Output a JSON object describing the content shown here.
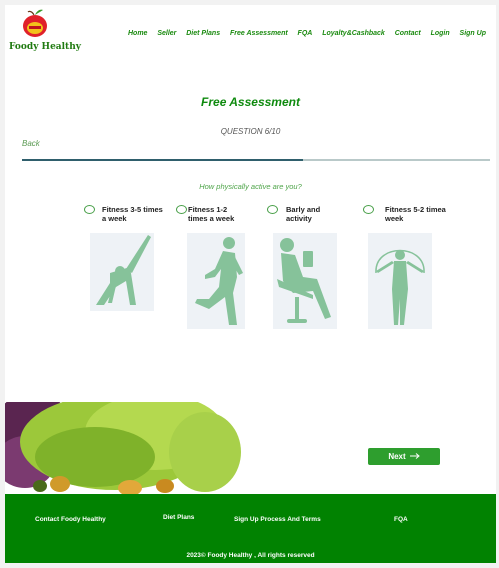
{
  "header": {
    "logo_text": "Foody Healthy",
    "nav": [
      "Home",
      "Seller",
      "Diet Plans",
      "Free Assessment",
      "FQA",
      "Loyalty&Cashback",
      "Contact",
      "Login",
      "Sign Up"
    ]
  },
  "assessment": {
    "title": "Free Assessment",
    "question_counter": "QUESTION 6/10",
    "back_label": "Back",
    "progress": 0.6,
    "question": "How physically active are you?",
    "options": [
      {
        "label": "Fitness 3-5 times a week"
      },
      {
        "label": "Fitness 1-2 times a week"
      },
      {
        "label": "Barly and activity"
      },
      {
        "label": "Fitness 5-2 timea week"
      }
    ],
    "next_label": "Next",
    "next_icon": "arrow-right-icon"
  },
  "footer": {
    "links": [
      "Contact Foody Healthy",
      "Diet Plans",
      "Sign Up Process And Terms",
      "FQA"
    ],
    "copyright": "2023© Foody Healthy , All rights reserved"
  },
  "colors": {
    "brand_green": "#018201",
    "button_green": "#2e9e2e",
    "figure_green": "#86c29a",
    "progress_fill": "#2f5f6c"
  }
}
